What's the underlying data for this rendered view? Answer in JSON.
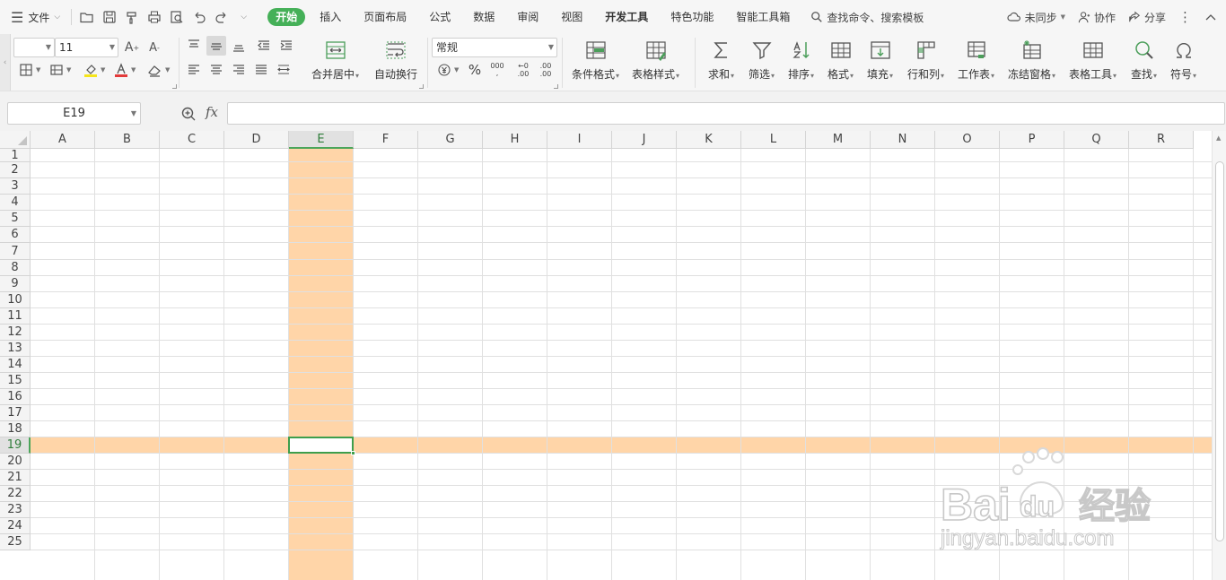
{
  "app": {
    "file_menu": "文件",
    "tabs": [
      "开始",
      "插入",
      "页面布局",
      "公式",
      "数据",
      "审阅",
      "视图",
      "开发工具",
      "特色功能",
      "智能工具箱"
    ],
    "search_placeholder": "查找命令、搜索模板",
    "sync_label": "未同步",
    "collab_label": "协作",
    "share_label": "分享"
  },
  "ribbon": {
    "font_name": "",
    "font_size": "11",
    "number_format": "常规",
    "merge_center": "合并居中",
    "auto_wrap": "自动换行",
    "conditional_format": "条件格式",
    "table_style": "表格样式",
    "sum": "求和",
    "filter": "筛选",
    "sort": "排序",
    "format": "格式",
    "fill": "填充",
    "row_col": "行和列",
    "worksheet": "工作表",
    "freeze": "冻结窗格",
    "table_tools": "表格工具",
    "find": "查找",
    "symbol": "符号",
    "percent": "%",
    "thousands": "000",
    "inc_decimal": ".00",
    "dec_decimal": ".00"
  },
  "formula_bar": {
    "name_box": "E19",
    "fx_label": "fx",
    "formula": ""
  },
  "grid": {
    "columns": [
      "A",
      "B",
      "C",
      "D",
      "E",
      "F",
      "G",
      "H",
      "I",
      "J",
      "K",
      "L",
      "M",
      "N",
      "O",
      "P",
      "Q",
      "R"
    ],
    "rows": [
      "1",
      "2",
      "3",
      "4",
      "5",
      "6",
      "7",
      "8",
      "9",
      "10",
      "11",
      "12",
      "13",
      "14",
      "15",
      "16",
      "17",
      "18",
      "19",
      "20",
      "21",
      "22",
      "23",
      "24",
      "25"
    ],
    "active_column": "E",
    "active_row": "19",
    "highlight_color": "#ffd5a8",
    "selection_color": "#3e9e4c"
  },
  "watermark": {
    "brand": "Bai du 经验",
    "url": "jingyan.baidu.com"
  }
}
